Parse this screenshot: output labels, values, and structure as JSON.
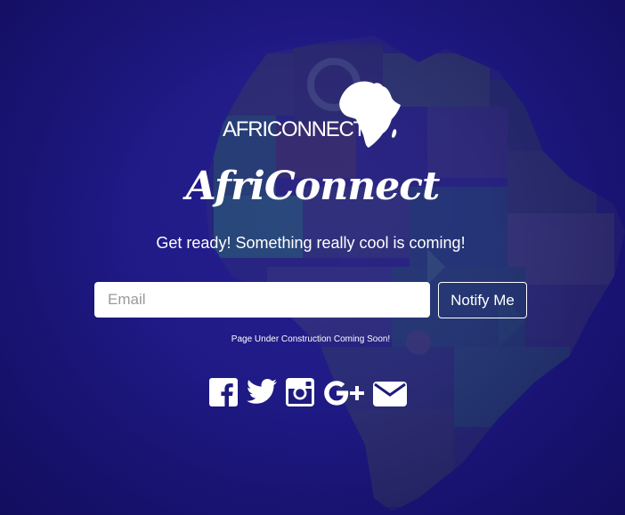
{
  "logo": {
    "text": "AFRICONNECT"
  },
  "brand": {
    "title": "AfriConnect"
  },
  "hero": {
    "tagline": "Get ready! Something really cool is coming!"
  },
  "signup": {
    "email_placeholder": "Email",
    "notify_label": "Notify Me"
  },
  "notice": {
    "text": "Page Under Construction Coming Soon!"
  },
  "social": {
    "icons": [
      "facebook-icon",
      "twitter-icon",
      "instagram-icon",
      "google-plus-icon",
      "email-icon"
    ]
  },
  "colors": {
    "background": "#1e1a7e",
    "text": "#ffffff"
  }
}
